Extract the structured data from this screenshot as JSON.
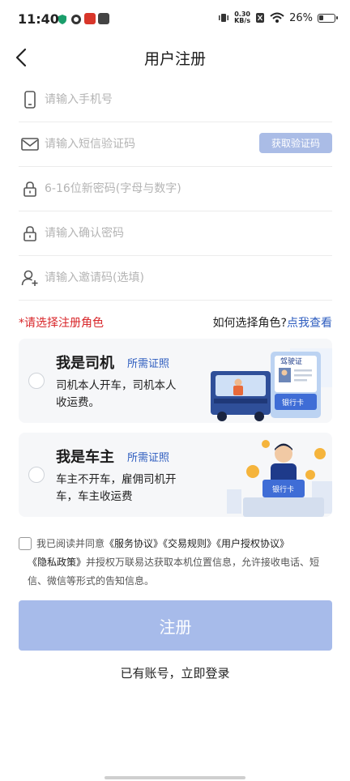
{
  "status_bar": {
    "time": "11:40",
    "network_speed_value": "0.30",
    "network_speed_unit": "KB/s",
    "battery": "26%"
  },
  "header": {
    "title": "用户注册"
  },
  "form": {
    "phone_placeholder": "请输入手机号",
    "sms_placeholder": "请输入短信验证码",
    "get_code_label": "获取验证码",
    "password_placeholder": "6-16位新密码(字母与数字)",
    "confirm_placeholder": "请输入确认密码",
    "invite_placeholder": "请输入邀请码(选填)"
  },
  "roles": {
    "prompt": "*请选择注册角色",
    "help_text": "如何选择角色?",
    "help_link": "点我查看",
    "driver": {
      "title": "我是司机",
      "docs_link": "所需证照",
      "description": "司机本人开车，司机本人收运费。",
      "license_label": "驾驶证",
      "card_label": "银行卡"
    },
    "owner": {
      "title": "我是车主",
      "docs_link": "所需证照",
      "description": "车主不开车，雇佣司机开车，车主收运费",
      "card_label": "银行卡"
    }
  },
  "agreement": {
    "prefix": "我已阅读并同意",
    "service": "《服务协议》",
    "trade": "《交易规则》",
    "auth": "《用户授权协议》",
    "privacy": "《隐私政策》",
    "suffix": "并授权万联易达获取本机位置信息，允许接收电话、短信、微信等形式的告知信息。"
  },
  "register_label": "注册",
  "login_label": "已有账号，立即登录",
  "colors": {
    "accent": "#2d5cbf",
    "button_disabled": "#a7bbea",
    "required": "#d8262a"
  }
}
